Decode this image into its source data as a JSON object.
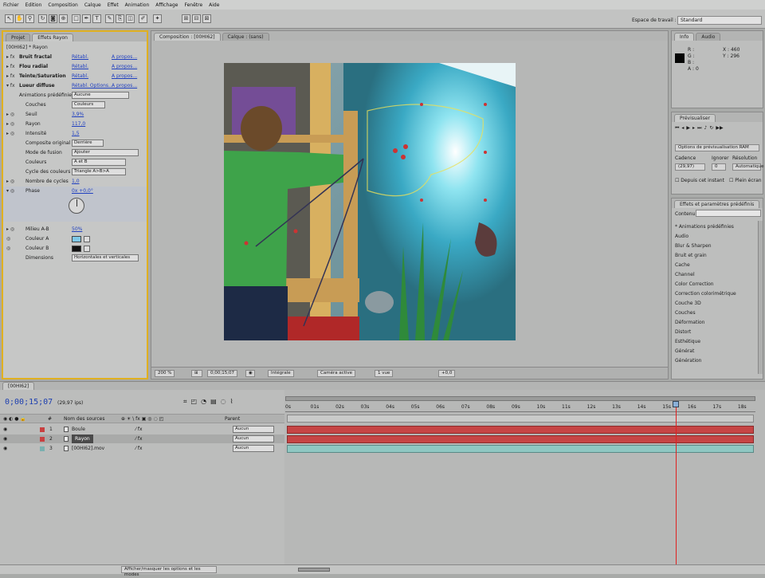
{
  "menu": [
    "Fichier",
    "Edition",
    "Composition",
    "Calque",
    "Effet",
    "Animation",
    "Affichage",
    "Fenêtre",
    "Aide"
  ],
  "workspace": {
    "label": "Espace de travail :",
    "value": "Standard"
  },
  "left_tabs": [
    "Projet",
    "Effets Rayon"
  ],
  "effects_header": "[00HI62] * Rayon",
  "effects": [
    {
      "name": "Bruit fractal",
      "reset": "Rétabl.",
      "about": "A propos..."
    },
    {
      "name": "Flou radial",
      "reset": "Rétabl.",
      "about": "A propos..."
    },
    {
      "name": "Teinte/Saturation",
      "reset": "Rétabl.",
      "about": "A propos..."
    },
    {
      "name": "Lueur diffuse",
      "reset": "Rétabl. Options...",
      "about": "A propos..."
    }
  ],
  "lueur_props": {
    "presets_label": "Animations prédéfinies",
    "presets_value": "Aucune",
    "couches_label": "Couches",
    "couches_value": "Couleurs",
    "seuil_label": "Seuil",
    "seuil_value": "3,9%",
    "rayon_label": "Rayon",
    "rayon_value": "117,0",
    "intensite_label": "Intensité",
    "intensite_value": "1,5",
    "composite_label": "Composite original",
    "composite_value": "Derrière",
    "mode_label": "Mode de fusion",
    "mode_value": "Ajouter",
    "couleurs_label": "Couleurs",
    "couleurs_value": "A et B",
    "cycle_label": "Cycle des couleurs",
    "cycle_value": "Triangle A>B>A",
    "nb_cycles_label": "Nombre de cycles",
    "nb_cycles_value": "1,0",
    "phase_label": "Phase",
    "phase_value": "0x +0,0°",
    "milieu_label": "Milieu A-B",
    "milieu_value": "50%",
    "couleurA_label": "Couleur A",
    "couleurA_color": "#7ec8e8",
    "couleurB_label": "Couleur B",
    "couleurB_color": "#111111",
    "dimensions_label": "Dimensions",
    "dimensions_value": "Horizontales et verticales"
  },
  "comp_tabs": [
    "Composition : [00HI62]",
    "Calque : (sans)"
  ],
  "comp_bottom": {
    "zoom": "200 %",
    "time": "0;00;15;07",
    "res": "Intégrale",
    "camera": "Caméra active",
    "views": "1 vue",
    "offset": "+0,0"
  },
  "info_tabs": [
    "Info",
    "Audio"
  ],
  "info": {
    "r": "R :",
    "g": "G :",
    "b": "B :",
    "a": "A : 0",
    "x": "X : 460",
    "y": "Y : 296"
  },
  "nav_tab": "Prévisualiser",
  "preview": {
    "options": "Options de prévisualisation RAM",
    "fps_label": "Cadence",
    "skip_label": "Ignorer",
    "res_label": "Résolution",
    "fps_value": "(29,97)",
    "skip_value": "0",
    "res_value": "Automatique",
    "from_current": "Depuis cet instant",
    "full_screen": "Plein écran"
  },
  "effects_tab": "Effets et paramètres prédéfinis",
  "search_label": "Contenu :",
  "effect_categories": [
    "* Animations prédéfinies",
    "Audio",
    "Blur & Sharpen",
    "Bruit et grain",
    "Cache",
    "Channel",
    "Color Correction",
    "Correction colorimétrique",
    "Couche 3D",
    "Couches",
    "Déformation",
    "Distort",
    "Esthétique",
    "Générat",
    "Génération"
  ],
  "timeline": {
    "tab": "[00HI62]",
    "time": "0;00;15;07",
    "fps": "(29,97 ips)",
    "col_source": "Nom des sources",
    "col_parent": "Parent",
    "layers": [
      {
        "num": "1",
        "name": "Boule",
        "color": "#c84040",
        "parent": "Aucun"
      },
      {
        "num": "2",
        "name": "Rayon",
        "color": "#c84040",
        "parent": "Aucun"
      },
      {
        "num": "3",
        "name": "[00HI62].mov",
        "color": "#7ab0b0",
        "parent": "Aucun"
      }
    ],
    "ruler": [
      "0s",
      "01s",
      "02s",
      "03s",
      "04s",
      "05s",
      "06s",
      "07s",
      "08s",
      "09s",
      "10s",
      "11s",
      "12s",
      "13s",
      "14s",
      "15s",
      "16s",
      "17s",
      "18s"
    ],
    "playhead_fraction": 0.83
  },
  "status": "Afficher/masquer les options et les modes"
}
